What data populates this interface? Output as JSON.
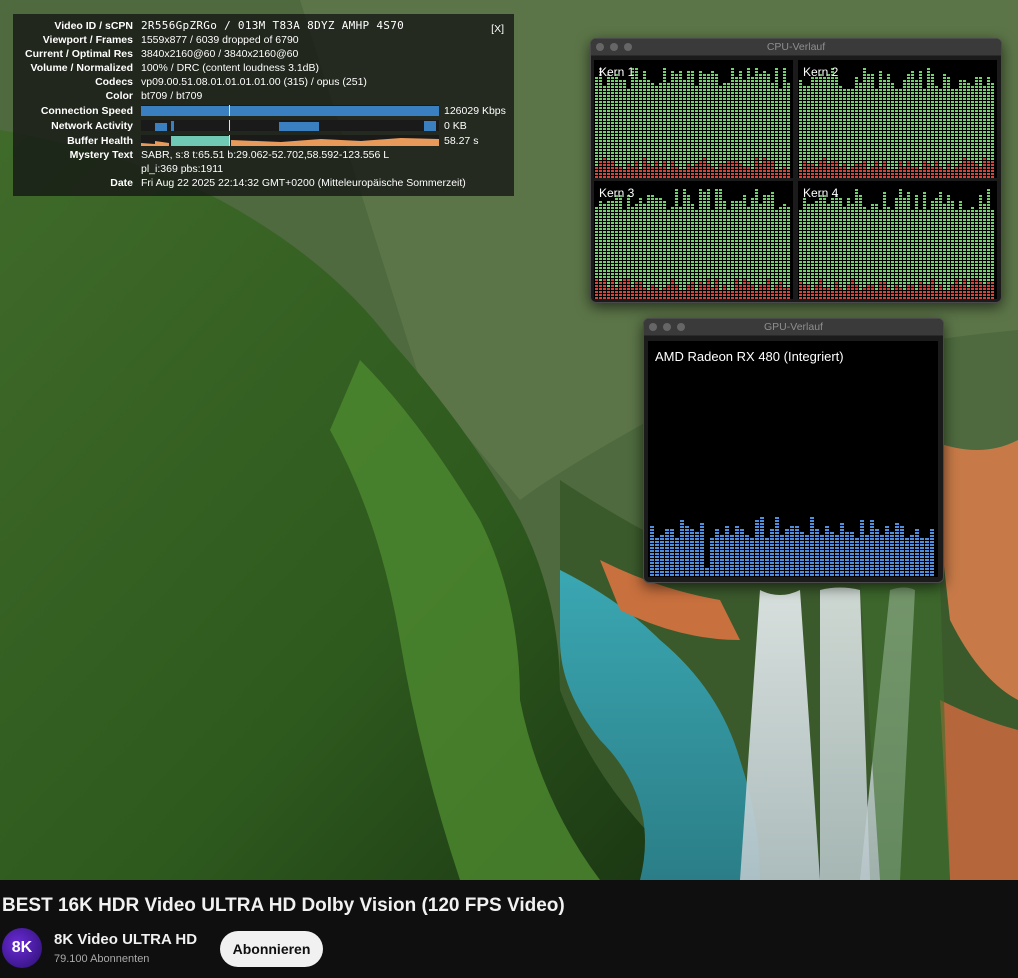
{
  "stats": {
    "close_label": "[X]",
    "rows": [
      {
        "label": "Video ID / sCPN",
        "value": "2R556GpZRGo / 013M T83A 8DYZ AMHP 4S70"
      },
      {
        "label": "Viewport / Frames",
        "value": "1559x877 / 6039 dropped of 6790"
      },
      {
        "label": "Current / Optimal Res",
        "value": "3840x2160@60 / 3840x2160@60"
      },
      {
        "label": "Volume / Normalized",
        "value": "100% / DRC (content loudness 3.1dB)"
      },
      {
        "label": "Codecs",
        "value": "vp09.00.51.08.01.01.01.01.00 (315) / opus (251)"
      },
      {
        "label": "Color",
        "value": "bt709 / bt709"
      }
    ],
    "graphs": [
      {
        "label": "Connection Speed",
        "value": "126029 Kbps"
      },
      {
        "label": "Network Activity",
        "value": "0 KB"
      },
      {
        "label": "Buffer Health",
        "value": "58.27 s"
      }
    ],
    "mystery_label": "Mystery Text",
    "mystery_line1": "SABR, s:8 t:65.51 b:29.062-52.702,58.592-123.556 L",
    "mystery_line2": "pl_i:369 pbs:1911",
    "date_label": "Date",
    "date_value": "Fri Aug 22 2025 22:14:32 GMT+0200 (Mitteleuropäische Sommerzeit)",
    "colors": {
      "connection": "#3a7fc0",
      "network": "#3a7fc0",
      "buffer_fill": "#6fc9b5",
      "buffer_line": "#e89a5a"
    }
  },
  "cpu_window": {
    "title": "CPU-Verlauf",
    "cores": [
      {
        "label": "Kern 1"
      },
      {
        "label": "Kern 2"
      },
      {
        "label": "Kern 3"
      },
      {
        "label": "Kern 4"
      }
    ],
    "colors": {
      "user": "#6fd36a",
      "system": "#d9443a"
    }
  },
  "gpu_window": {
    "title": "GPU-Verlauf",
    "gpu_name": "AMD Radeon RX 480 (Integriert)",
    "color": "#4f8fde"
  },
  "video": {
    "title": "BEST 16K HDR Video ULTRA HD Dolby Vision (120 FPS Video)",
    "channel_avatar_text": "8K",
    "channel_name": "8K Video ULTRA HD",
    "subscribers": "79.100 Abonnenten",
    "subscribe_label": "Abonnieren"
  }
}
